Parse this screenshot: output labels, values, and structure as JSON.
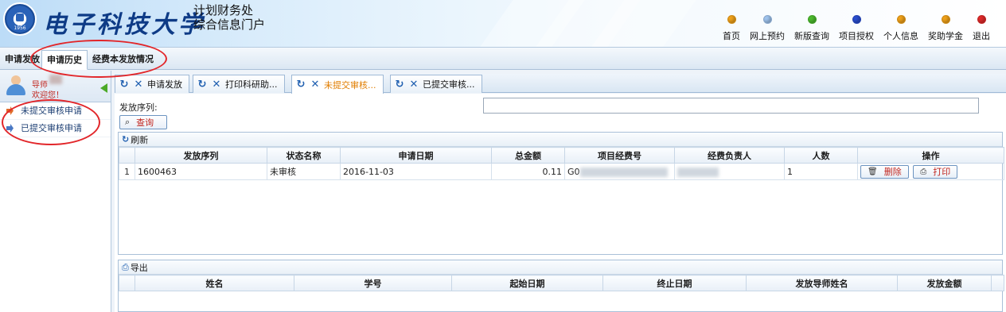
{
  "header": {
    "logo_year": "1956",
    "school_name": "电子科技大学",
    "subtitle_line1": "计划财务处",
    "subtitle_line2": "综合信息门户",
    "nav": [
      {
        "label": "首页",
        "color": "#f0a21a"
      },
      {
        "label": "网上预约",
        "color": "#9fc4ee"
      },
      {
        "label": "新版查询",
        "color": "#4cbb2e"
      },
      {
        "label": "项目授权",
        "color": "#2a4ed0"
      },
      {
        "label": "个人信息",
        "color": "#f0a21a"
      },
      {
        "label": "奖助学金",
        "color": "#f0a21a"
      },
      {
        "label": "退出",
        "color": "#e02a2a"
      }
    ]
  },
  "menu": {
    "tabs": [
      "申请发放",
      "申请历史",
      "经费本发放情况"
    ],
    "active_index": 1
  },
  "sidebar": {
    "role": "导师",
    "welcome": "欢迎您！",
    "items": [
      "未提交审核申请",
      "已提交审核申请"
    ]
  },
  "content_tabs": [
    {
      "label": "申请发放",
      "active": false
    },
    {
      "label": "打印科研助...",
      "active": false
    },
    {
      "label": "未提交审核...",
      "active": true
    },
    {
      "label": "已提交审核...",
      "active": false
    }
  ],
  "search": {
    "label": "发放序列:",
    "value": "",
    "query_button": "查询"
  },
  "upper_grid": {
    "toolbar_label": "刷新",
    "columns": [
      "发放序列",
      "状态名称",
      "申请日期",
      "总金额",
      "项目经费号",
      "经费负责人",
      "人数",
      "操作"
    ],
    "rows": [
      {
        "index": "1",
        "serial": "1600463",
        "status": "未审核",
        "date": "2016-11-03",
        "amount": "0.11",
        "project_no": "G0",
        "people": "1"
      }
    ],
    "actions": {
      "delete": "删除",
      "print": "打印"
    }
  },
  "lower_grid": {
    "toolbar_label": "导出",
    "columns": [
      "姓名",
      "学号",
      "起始日期",
      "终止日期",
      "发放导师姓名",
      "发放金额"
    ]
  }
}
